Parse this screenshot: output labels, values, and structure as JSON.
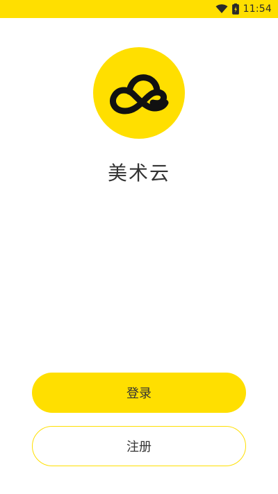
{
  "status_bar": {
    "time": "11:54",
    "wifi_icon": "wifi-icon",
    "battery_icon": "battery-charging-icon",
    "background_color": "#FFDF00"
  },
  "app": {
    "logo_icon": "cloud-logo-icon",
    "name": "美术云",
    "accent_color": "#FFDF00"
  },
  "actions": {
    "login_label": "登录",
    "register_label": "注册"
  }
}
